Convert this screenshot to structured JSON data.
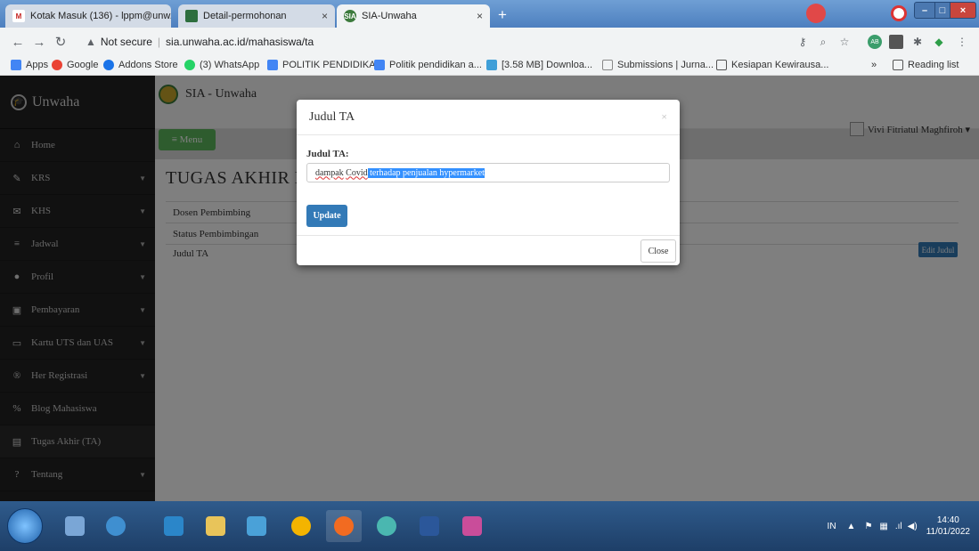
{
  "browser": {
    "tabs": [
      {
        "title": "Kotak Masuk (136) - lppm@unw...",
        "icon": "gmail-icon",
        "color": "#c5221f",
        "glyph": "M"
      },
      {
        "title": "Detail-permohonan",
        "icon": "page-favicon-icon",
        "color": "#2d6e3e",
        "glyph": ""
      },
      {
        "title": "SIA-Unwaha",
        "icon": "sia-favicon-icon",
        "color": "#3c7a3c",
        "glyph": "SIA"
      }
    ],
    "url_warning": "Not secure",
    "url": "sia.unwaha.ac.id/mahasiswa/ta",
    "bookmarks": [
      {
        "label": "Apps",
        "color": "#4285f4"
      },
      {
        "label": "Google",
        "color": "#ea4335"
      },
      {
        "label": "Addons Store",
        "color": "#1a73e8"
      },
      {
        "label": "(3) WhatsApp",
        "color": "#25d366"
      },
      {
        "label": "POLITIK PENDIDIKA...",
        "color": "#4285f4"
      },
      {
        "label": "Politik pendidikan a...",
        "color": "#4285f4"
      },
      {
        "label": "[3.58 MB] Downloa...",
        "color": "#3f9fd8"
      },
      {
        "label": "Submissions | Jurna...",
        "color": "#888888"
      },
      {
        "label": "Kesiapan Kewirausa...",
        "color": "#555555"
      }
    ],
    "reading_list": "Reading list",
    "more_bookmarks": "»"
  },
  "sidebar": {
    "brand": "Unwaha",
    "items": [
      {
        "label": "Home",
        "icon": "home-icon",
        "glyph": "⌂",
        "chevron": false
      },
      {
        "label": "KRS",
        "icon": "edit-icon",
        "glyph": "✎",
        "chevron": true
      },
      {
        "label": "KHS",
        "icon": "envelope-icon",
        "glyph": "✉",
        "chevron": true
      },
      {
        "label": "Jadwal",
        "icon": "list-icon",
        "glyph": "≡",
        "chevron": true
      },
      {
        "label": "Profil",
        "icon": "user-icon",
        "glyph": "●",
        "chevron": true
      },
      {
        "label": "Pembayaran",
        "icon": "money-icon",
        "glyph": "▣",
        "chevron": true
      },
      {
        "label": "Kartu UTS dan UAS",
        "icon": "card-icon",
        "glyph": "▭",
        "chevron": true
      },
      {
        "label": "Her Registrasi",
        "icon": "registered-icon",
        "glyph": "®",
        "chevron": true
      },
      {
        "label": "Blog Mahasiswa",
        "icon": "link-icon",
        "glyph": "%",
        "chevron": false
      },
      {
        "label": "Tugas Akhir (TA)",
        "icon": "book-icon",
        "glyph": "▤",
        "chevron": false
      },
      {
        "label": "Tentang",
        "icon": "question-icon",
        "glyph": "?",
        "chevron": true
      }
    ]
  },
  "header": {
    "title": "SIA - Unwaha",
    "menu_label": "≡ Menu",
    "user_name": "Vivi Fitriatul Maghfiroh ▾"
  },
  "main": {
    "heading": "TUGAS AKHIR MA",
    "rows": [
      "Dosen Pembimbing",
      "Status Pembimbingan",
      "Judul TA"
    ],
    "edit_button": "Edit Judul"
  },
  "modal": {
    "title": "Judul TA",
    "close_x": "×",
    "label": "Judul TA:",
    "input_part1": "dampak",
    "input_part2": "Covid",
    "input_selected": "terhadap penjualan hypermarket",
    "update_button": "Update",
    "close_button": "Close"
  },
  "taskbar": {
    "language": "IN",
    "time": "14:40",
    "date": "11/01/2022"
  }
}
